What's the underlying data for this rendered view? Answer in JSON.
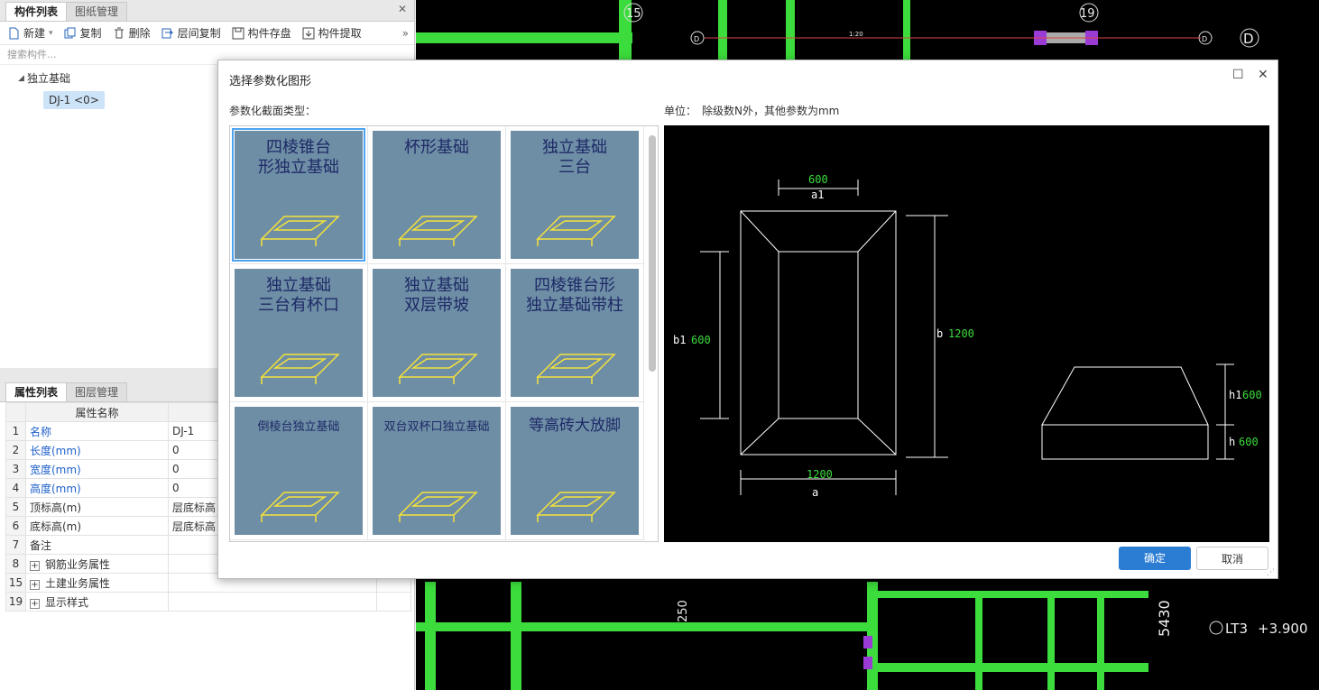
{
  "left_panel": {
    "tabs": [
      "构件列表",
      "图纸管理"
    ],
    "toolbar": [
      "新建",
      "复制",
      "删除",
      "层间复制",
      "构件存盘",
      "构件提取"
    ],
    "search_placeholder": "搜索构件...",
    "tree_root": "独立基础",
    "tree_child": "DJ-1 <0>"
  },
  "props": {
    "tabs": [
      "属性列表",
      "图层管理"
    ],
    "header": "属性名称",
    "rows": [
      {
        "n": "1",
        "name": "名称",
        "val": "DJ-1",
        "blue": true
      },
      {
        "n": "2",
        "name": "长度(mm)",
        "val": "0",
        "blue": true
      },
      {
        "n": "3",
        "name": "宽度(mm)",
        "val": "0",
        "blue": true
      },
      {
        "n": "4",
        "name": "高度(mm)",
        "val": "0",
        "blue": true
      },
      {
        "n": "5",
        "name": "顶标高(m)",
        "val": "层底标高",
        "blue": false
      },
      {
        "n": "6",
        "name": "底标高(m)",
        "val": "层底标高",
        "blue": false
      },
      {
        "n": "7",
        "name": "备注",
        "val": "",
        "blue": false
      },
      {
        "n": "8",
        "name": "钢筋业务属性",
        "val": "",
        "blue": false,
        "expand": true
      },
      {
        "n": "15",
        "name": "土建业务属性",
        "val": "",
        "blue": false,
        "expand": true
      },
      {
        "n": "19",
        "name": "显示样式",
        "val": "",
        "blue": false,
        "expand": true
      }
    ]
  },
  "cad": {
    "axis_labels": [
      "15",
      "19",
      "D",
      "D",
      "D"
    ],
    "texts": [
      "1:20",
      "250",
      "5430",
      "LT3",
      "+3.900"
    ]
  },
  "dialog": {
    "title": "选择参数化图形",
    "type_label": "参数化截面类型：",
    "unit_label": "单位：",
    "unit_text": "除级数N外，其他参数为mm",
    "ok": "确定",
    "cancel": "取消",
    "shapes": [
      {
        "title1": "四棱锥台",
        "title2": "形独立基础"
      },
      {
        "title1": "杯形基础",
        "title2": ""
      },
      {
        "title1": "独立基础",
        "title2": "三台"
      },
      {
        "title1": "独立基础",
        "title2": "三台有杯口"
      },
      {
        "title1": "独立基础",
        "title2": "双层带坡"
      },
      {
        "title1": "四棱锥台形",
        "title2": "独立基础带柱"
      },
      {
        "title1": "倒棱台独立基础",
        "title2": ""
      },
      {
        "title1": "双台双杯口独立基础",
        "title2": ""
      },
      {
        "title1": "等高砖大放脚",
        "title2": ""
      }
    ],
    "preview": {
      "a1": "600",
      "a1_name": "a1",
      "b1": "600",
      "b1_name": "b1",
      "b": "1200",
      "b_name": "b",
      "a": "1200",
      "a_name": "a",
      "h1": "600",
      "h1_name": "h1",
      "h": "600",
      "h_name": "h"
    }
  },
  "colors": {
    "accent": "#2b7cd3",
    "thumb": "#6e8ea6",
    "cad_green": "#3cdc3c"
  }
}
